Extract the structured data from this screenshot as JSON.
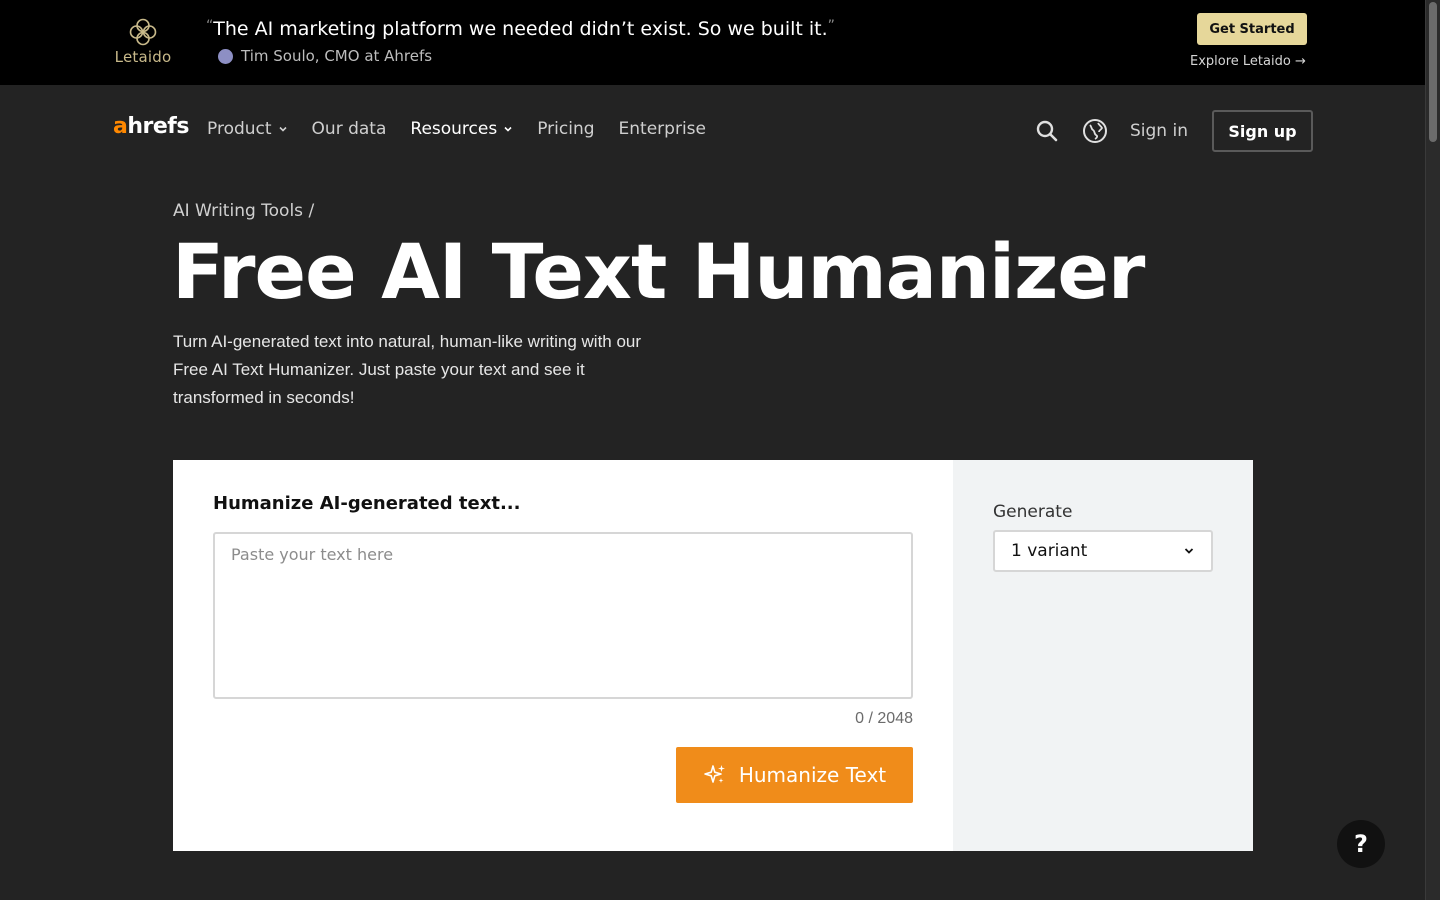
{
  "promo": {
    "logo_text": "Letaido",
    "quote": "The AI marketing platform we needed didn’t exist. So we built it.",
    "quote_open": "“",
    "quote_close": "”",
    "author": "Tim Soulo, CMO at Ahrefs",
    "cta_label": "Get Started",
    "explore_label": "Explore Letaido →",
    "brand_color": "#e6d79a"
  },
  "nav": {
    "logo_a": "a",
    "logo_rest": "hrefs",
    "items": [
      {
        "label": "Product"
      },
      {
        "label": "Our data"
      },
      {
        "label": "Resources"
      },
      {
        "label": "Pricing"
      },
      {
        "label": "Enterprise"
      }
    ],
    "search_icon": "search-icon",
    "language_icon": "globe-icon",
    "signin_label": "Sign in",
    "signup_label": "Sign up"
  },
  "hero": {
    "breadcrumb": "AI Writing Tools /",
    "title": "Free AI Text Humanizer",
    "description": "Turn AI-generated text into natural, human-like writing with our Free AI Text Humanizer. Just paste your text and see it transformed in seconds!"
  },
  "tool": {
    "heading": "Humanize AI-generated text...",
    "input_value": "",
    "input_placeholder": "Paste your text here",
    "counter": "0 / 2048",
    "button_label": "Humanize Text",
    "button_color": "#f08c1a",
    "generate_label": "Generate",
    "variant_selected": "1 variant"
  },
  "help": {
    "label": "?"
  },
  "colors": {
    "background": "#232323",
    "accent": "#ff8800"
  }
}
